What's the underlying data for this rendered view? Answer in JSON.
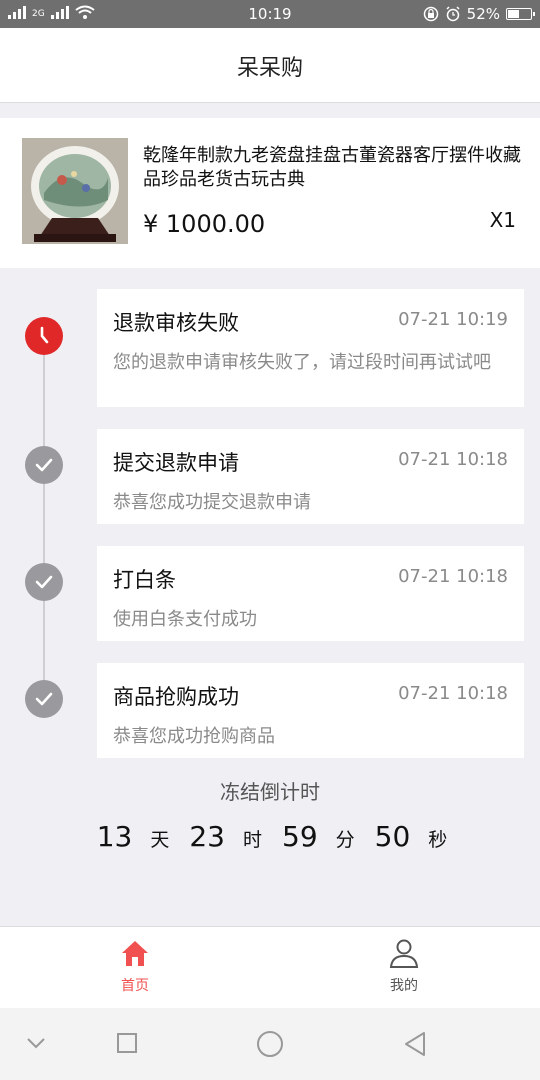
{
  "status_bar": {
    "network": "2G",
    "time": "10:19",
    "battery": "52%",
    "battery_level": 0.52
  },
  "header": {
    "title": "呆呆购"
  },
  "product": {
    "name": "乾隆年制款九老瓷盘挂盘古董瓷器客厅摆件收藏品珍品老货古玩古典",
    "price": "¥ 1000.00",
    "quantity": "X1"
  },
  "timeline": [
    {
      "title": "退款审核失败",
      "time": "07-21 10:19",
      "desc": "您的退款申请审核失败了，请过段时间再试试吧",
      "status": "failed",
      "icon": "clock-icon",
      "color": "#e02828"
    },
    {
      "title": "提交退款申请",
      "time": "07-21 10:18",
      "desc": "恭喜您成功提交退款申请",
      "status": "done",
      "icon": "check-icon",
      "color": "#9a9a9e"
    },
    {
      "title": "打白条",
      "time": "07-21 10:18",
      "desc": "使用白条支付成功",
      "status": "done",
      "icon": "check-icon",
      "color": "#9a9a9e"
    },
    {
      "title": "商品抢购成功",
      "time": "07-21 10:18",
      "desc": "恭喜您成功抢购商品",
      "status": "done",
      "icon": "check-icon",
      "color": "#9a9a9e"
    }
  ],
  "countdown": {
    "label": "冻结倒计时",
    "days": "13",
    "days_unit": "天",
    "hours": "23",
    "hours_unit": "时",
    "minutes": "59",
    "minutes_unit": "分",
    "seconds": "50",
    "seconds_unit": "秒"
  },
  "tabbar": {
    "home": {
      "label": "首页",
      "icon": "home-icon",
      "active": true,
      "color": "#f05050"
    },
    "mine": {
      "label": "我的",
      "icon": "user-icon",
      "active": false,
      "color": "#555555"
    }
  }
}
